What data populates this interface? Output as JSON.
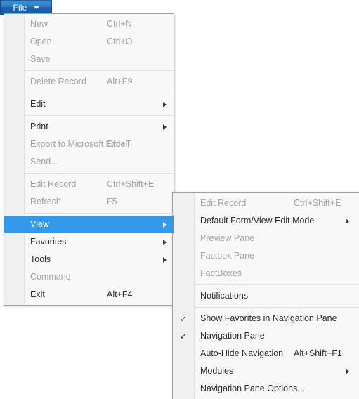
{
  "ribbon": {
    "file_button": {
      "label": "File",
      "caret_icon": "chevron-down-icon"
    }
  },
  "colors": {
    "accent_blue": "#3399ea",
    "file_button_blue": "#2e7cc4",
    "menu_background": "#f8f8f8",
    "gutter_background": "#f0f0f0",
    "text_enabled": "#2b2b2b",
    "text_disabled": "#a3a3a3",
    "separator": "#e0e0e0"
  },
  "file_menu": {
    "groups": [
      {
        "items": [
          {
            "label": "New",
            "accel": "Ctrl+N",
            "enabled": false,
            "submenu": false,
            "checked": false
          },
          {
            "label": "Open",
            "accel": "Ctrl+O",
            "enabled": false,
            "submenu": false,
            "checked": false
          },
          {
            "label": "Save",
            "accel": "",
            "enabled": false,
            "submenu": false,
            "checked": false
          }
        ]
      },
      {
        "items": [
          {
            "label": "Delete Record",
            "accel": "Alt+F9",
            "enabled": false,
            "submenu": false,
            "checked": false
          }
        ]
      },
      {
        "items": [
          {
            "label": "Edit",
            "accel": "",
            "enabled": true,
            "submenu": true,
            "checked": false
          }
        ]
      },
      {
        "items": [
          {
            "label": "Print",
            "accel": "",
            "enabled": true,
            "submenu": true,
            "checked": false
          },
          {
            "label": "Export to Microsoft Excel",
            "accel": "Ctrl+T",
            "enabled": false,
            "submenu": false,
            "checked": false
          },
          {
            "label": "Send...",
            "accel": "",
            "enabled": false,
            "submenu": false,
            "checked": false
          }
        ]
      },
      {
        "items": [
          {
            "label": "Edit Record",
            "accel": "Ctrl+Shift+E",
            "enabled": false,
            "submenu": false,
            "checked": false
          },
          {
            "label": "Refresh",
            "accel": "F5",
            "enabled": false,
            "submenu": false,
            "checked": false
          }
        ]
      },
      {
        "items": [
          {
            "label": "View",
            "accel": "",
            "enabled": true,
            "submenu": true,
            "checked": false,
            "highlighted": true
          },
          {
            "label": "Favorites",
            "accel": "",
            "enabled": true,
            "submenu": true,
            "checked": false
          },
          {
            "label": "Tools",
            "accel": "",
            "enabled": true,
            "submenu": true,
            "checked": false
          },
          {
            "label": "Command",
            "accel": "",
            "enabled": false,
            "submenu": false,
            "checked": false
          },
          {
            "label": "Exit",
            "accel": "Alt+F4",
            "enabled": true,
            "submenu": false,
            "checked": false
          }
        ]
      }
    ]
  },
  "view_submenu": {
    "groups": [
      {
        "items": [
          {
            "label": "Edit Record",
            "accel": "Ctrl+Shift+E",
            "enabled": false,
            "submenu": false,
            "checked": false
          },
          {
            "label": "Default Form/View Edit Mode",
            "accel": "",
            "enabled": true,
            "submenu": true,
            "checked": false
          },
          {
            "label": "Preview Pane",
            "accel": "",
            "enabled": false,
            "submenu": false,
            "checked": false
          },
          {
            "label": "Factbox Pane",
            "accel": "",
            "enabled": false,
            "submenu": false,
            "checked": false
          },
          {
            "label": "FactBoxes",
            "accel": "",
            "enabled": false,
            "submenu": false,
            "checked": false
          }
        ]
      },
      {
        "items": [
          {
            "label": "Notifications",
            "accel": "",
            "enabled": true,
            "submenu": false,
            "checked": false
          }
        ]
      },
      {
        "items": [
          {
            "label": "Show Favorites in Navigation Pane",
            "accel": "",
            "enabled": true,
            "submenu": false,
            "checked": true
          },
          {
            "label": "Navigation Pane",
            "accel": "",
            "enabled": true,
            "submenu": false,
            "checked": true
          },
          {
            "label": "Auto-Hide Navigation",
            "accel": "Alt+Shift+F1",
            "enabled": true,
            "submenu": false,
            "checked": false
          },
          {
            "label": "Modules",
            "accel": "",
            "enabled": true,
            "submenu": true,
            "checked": false
          },
          {
            "label": "Navigation Pane Options...",
            "accel": "",
            "enabled": true,
            "submenu": false,
            "checked": false
          }
        ]
      }
    ]
  },
  "icons": {
    "check_glyph": "✓",
    "submenu_arrow": "submenu-arrow-icon"
  }
}
